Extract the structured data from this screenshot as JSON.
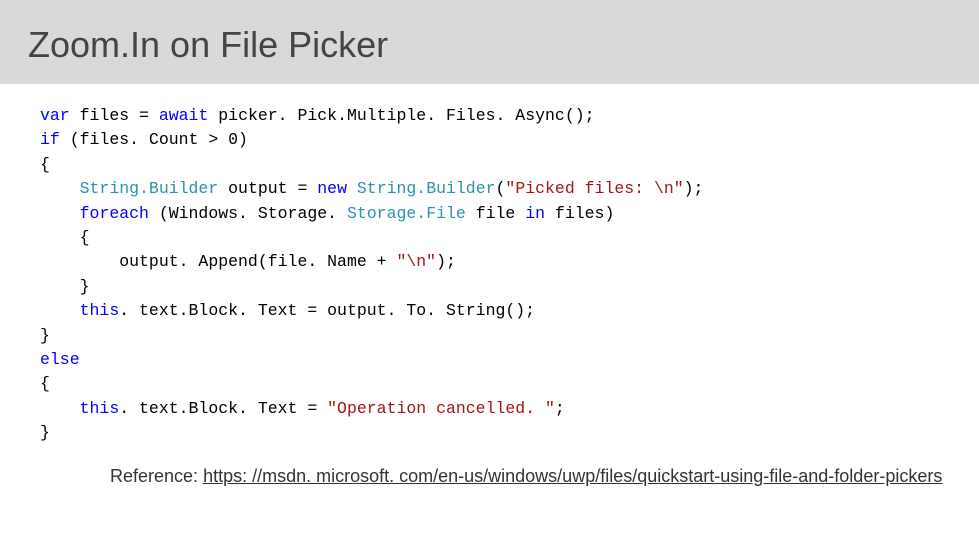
{
  "title": "Zoom.In on File Picker",
  "code_tokens": [
    {
      "t": "var",
      "c": "kw"
    },
    {
      "t": " files = "
    },
    {
      "t": "await",
      "c": "kw"
    },
    {
      "t": " picker. Pick.Multiple. Files. Async();\n"
    },
    {
      "t": "if",
      "c": "kw"
    },
    {
      "t": " (files. Count > 0)\n"
    },
    {
      "t": "{\n"
    },
    {
      "t": "    "
    },
    {
      "t": "String.",
      "c": "typ"
    },
    {
      "t": "Builder",
      "c": "typ"
    },
    {
      "t": " output = "
    },
    {
      "t": "new",
      "c": "kw"
    },
    {
      "t": " "
    },
    {
      "t": "String.",
      "c": "typ"
    },
    {
      "t": "Builder",
      "c": "typ"
    },
    {
      "t": "("
    },
    {
      "t": "\"Picked files: \\n\"",
      "c": "str"
    },
    {
      "t": ");\n"
    },
    {
      "t": "    "
    },
    {
      "t": "foreach",
      "c": "kw"
    },
    {
      "t": " (Windows. Storage. "
    },
    {
      "t": "Storage.",
      "c": "typ"
    },
    {
      "t": "File",
      "c": "typ"
    },
    {
      "t": " file "
    },
    {
      "t": "in",
      "c": "kw"
    },
    {
      "t": " files)\n"
    },
    {
      "t": "    {\n"
    },
    {
      "t": "        output. Append(file. Name + "
    },
    {
      "t": "\"\\n\"",
      "c": "str"
    },
    {
      "t": ");\n"
    },
    {
      "t": "    }\n"
    },
    {
      "t": "    "
    },
    {
      "t": "this",
      "c": "kw"
    },
    {
      "t": ". text.Block. Text = output. To. String();\n"
    },
    {
      "t": "}\n"
    },
    {
      "t": "else",
      "c": "kw"
    },
    {
      "t": "\n"
    },
    {
      "t": "{\n"
    },
    {
      "t": "    "
    },
    {
      "t": "this",
      "c": "kw"
    },
    {
      "t": ". text.Block. Text = "
    },
    {
      "t": "\"Operation cancelled. \"",
      "c": "str"
    },
    {
      "t": ";\n"
    },
    {
      "t": "}"
    }
  ],
  "reference_label": "Reference: ",
  "reference_url_text": "https: //msdn. microsoft. com/en-us/windows/uwp/files/quickstart-using-file-and-folder-pickers"
}
